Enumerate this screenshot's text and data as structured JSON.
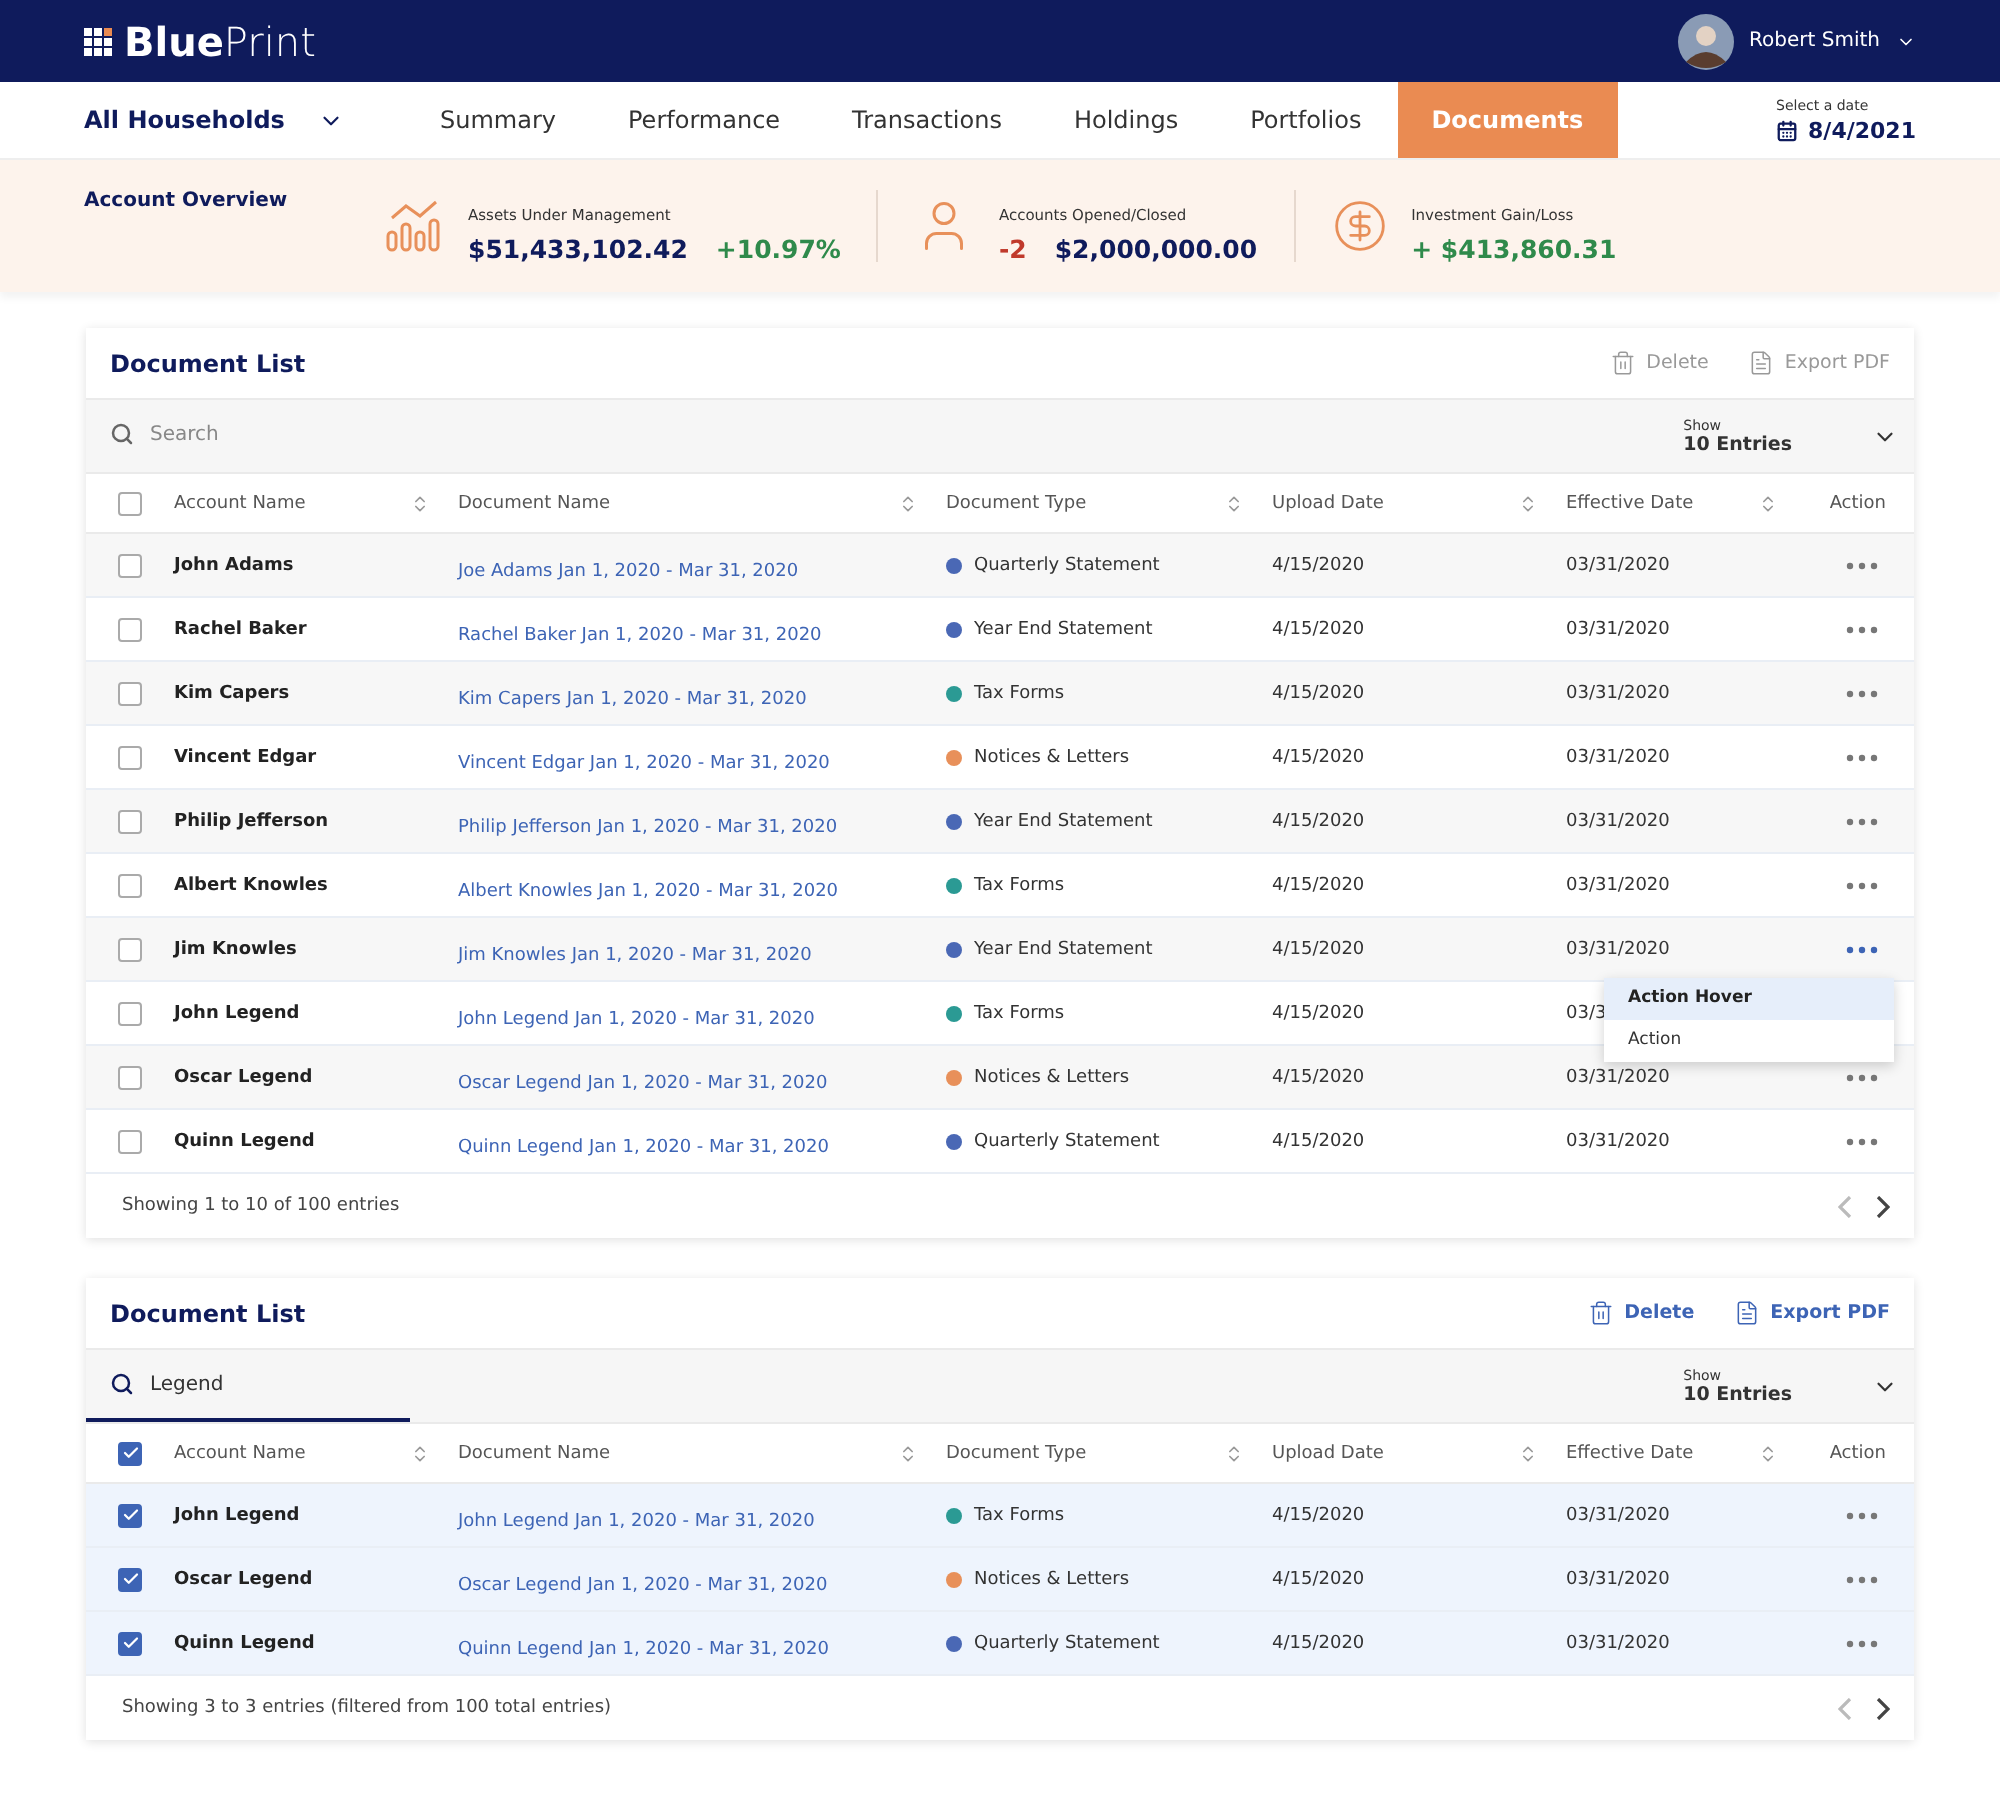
{
  "brand": {
    "name": "**Blue**Print"
  },
  "user": {
    "name": "Robert Smith"
  },
  "nav": {
    "household": "All Households",
    "tabs": [
      {
        "label": "Summary",
        "selected": false
      },
      {
        "label": "Performance",
        "selected": false
      },
      {
        "label": "Transactions",
        "selected": false
      },
      {
        "label": "Holdings",
        "selected": false
      },
      {
        "label": "Portfolios",
        "selected": false
      },
      {
        "label": "Documents",
        "selected": true
      }
    ],
    "date_label": "Select a date",
    "date": "8/4/2021"
  },
  "overview": {
    "title": "Account Overview",
    "stats": [
      {
        "kind": "chart",
        "label": "Assets Under Management",
        "figures": [
          {
            "text": "$51,433,102.42",
            "color": "#0f1b5c"
          },
          {
            "text": "+10.97%",
            "color": "#2f8a4b"
          }
        ]
      },
      {
        "kind": "person",
        "label": "Accounts Opened/Closed",
        "figures": [
          {
            "text": "-2",
            "color": "#c0392b"
          },
          {
            "text": "$2,000,000.00",
            "color": "#0f1b5c"
          }
        ]
      },
      {
        "kind": "dollar",
        "label": "Investment Gain/Loss",
        "figures": [
          {
            "text": "+ $413,860.31",
            "color": "#2f8a4b"
          }
        ]
      }
    ]
  },
  "lists": [
    {
      "title": "Document List",
      "actions_enabled": false,
      "delete": "Delete",
      "export": "Export PDF",
      "search": {
        "placeholder": "Search",
        "focused": false
      },
      "show_label": "Show",
      "entries": "10 Entries",
      "all_checked": false,
      "columns": [
        "Account Name",
        "Document Name",
        "Document Type",
        "Upload Date",
        "Effective Date",
        "Action"
      ],
      "rows": [
        {
          "account": "John Adams",
          "document": "Joe Adams Jan 1, 2020 - Mar 31, 2020",
          "type": "Quarterly Statement",
          "color": "#4a68b5",
          "upload": "4/15/2020",
          "effective": "03/31/2020",
          "checked": false,
          "action_visible": true,
          "menu_open": false
        },
        {
          "account": "Rachel Baker",
          "document": "Rachel Baker Jan 1, 2020 - Mar 31, 2020",
          "type": "Year End Statement",
          "color": "#4a68b5",
          "upload": "4/15/2020",
          "effective": "03/31/2020",
          "checked": false,
          "action_visible": true,
          "menu_open": false
        },
        {
          "account": "Kim Capers",
          "document": "Kim Capers Jan 1, 2020 - Mar 31, 2020",
          "type": "Tax Forms",
          "color": "#2b9a94",
          "upload": "4/15/2020",
          "effective": "03/31/2020",
          "checked": false,
          "action_visible": true,
          "menu_open": false
        },
        {
          "account": "Vincent Edgar",
          "document": "Vincent Edgar Jan 1, 2020 - Mar 31, 2020",
          "type": "Notices & Letters",
          "color": "#e8905a",
          "upload": "4/15/2020",
          "effective": "03/31/2020",
          "checked": false,
          "action_visible": true,
          "menu_open": false
        },
        {
          "account": "Philip Jefferson",
          "document": "Philip Jefferson Jan 1, 2020 - Mar 31, 2020",
          "type": "Year End Statement",
          "color": "#4a68b5",
          "upload": "4/15/2020",
          "effective": "03/31/2020",
          "checked": false,
          "action_visible": true,
          "menu_open": false
        },
        {
          "account": "Albert Knowles",
          "document": "Albert  Knowles Jan 1, 2020 - Mar 31, 2020",
          "type": "Tax Forms",
          "color": "#2b9a94",
          "upload": "4/15/2020",
          "effective": "03/31/2020",
          "checked": false,
          "action_visible": true,
          "menu_open": false
        },
        {
          "account": "Jim Knowles",
          "document": "Jim  Knowles Jan 1, 2020 - Mar 31, 2020",
          "type": "Year End Statement",
          "color": "#4a68b5",
          "upload": "4/15/2020",
          "effective": "03/31/2020",
          "checked": false,
          "action_visible": true,
          "menu_open": true
        },
        {
          "account": "John Legend",
          "document": "John Legend Jan 1, 2020 - Mar 31, 2020",
          "type": "Tax Forms",
          "color": "#2b9a94",
          "upload": "4/15/2020",
          "effective": "03/3",
          "checked": false
        },
        {
          "account": "Oscar Legend",
          "document": "Oscar Legend  Jan 1, 2020 - Mar 31, 2020",
          "type": "Notices & Letters",
          "color": "#e8905a",
          "upload": "4/15/2020",
          "effective": "03/31/2020",
          "checked": false,
          "action_visible": true,
          "menu_open": false
        },
        {
          "account": "Quinn Legend",
          "document": "Quinn Legend  Jan 1, 2020 - Mar 31, 2020",
          "type": "Quarterly Statement",
          "color": "#4a68b5",
          "upload": "4/15/2020",
          "effective": "03/31/2020",
          "checked": false,
          "action_visible": true,
          "menu_open": false
        }
      ],
      "menu": [
        {
          "label": "Action Hover",
          "hovered": true
        },
        {
          "label": "Action",
          "hovered": false
        }
      ],
      "footer": "Showing 1 to 10 of 100 entries"
    },
    {
      "title": "Document List",
      "actions_enabled": true,
      "delete": "Delete",
      "export": "Export PDF",
      "search": {
        "value": "Legend",
        "focused": true
      },
      "show_label": "Show",
      "entries": "10 Entries",
      "all_checked": true,
      "columns": [
        "Account Name",
        "Document Name",
        "Document Type",
        "Upload Date",
        "Effective Date",
        "Action"
      ],
      "rows": [
        {
          "account": "John Legend",
          "document": "John Legend Jan 1, 2020 - Mar 31, 2020",
          "type": "Tax Forms",
          "color": "#2b9a94",
          "upload": "4/15/2020",
          "effective": "03/31/2020",
          "checked": true,
          "action_visible": true,
          "menu_open": false
        },
        {
          "account": "Oscar Legend",
          "document": "Oscar Legend  Jan 1, 2020 - Mar 31, 2020",
          "type": "Notices & Letters",
          "color": "#e8905a",
          "upload": "4/15/2020",
          "effective": "03/31/2020",
          "checked": true,
          "action_visible": true,
          "menu_open": false
        },
        {
          "account": "Quinn Legend",
          "document": "Quinn Legend  Jan 1, 2020 - Mar 31, 2020",
          "type": "Quarterly Statement",
          "color": "#4a68b5",
          "upload": "4/15/2020",
          "effective": "03/31/2020",
          "checked": true,
          "action_visible": true,
          "menu_open": false
        }
      ],
      "footer": "Showing 3 to 3 entries (filtered from 100 total entries)"
    }
  ]
}
